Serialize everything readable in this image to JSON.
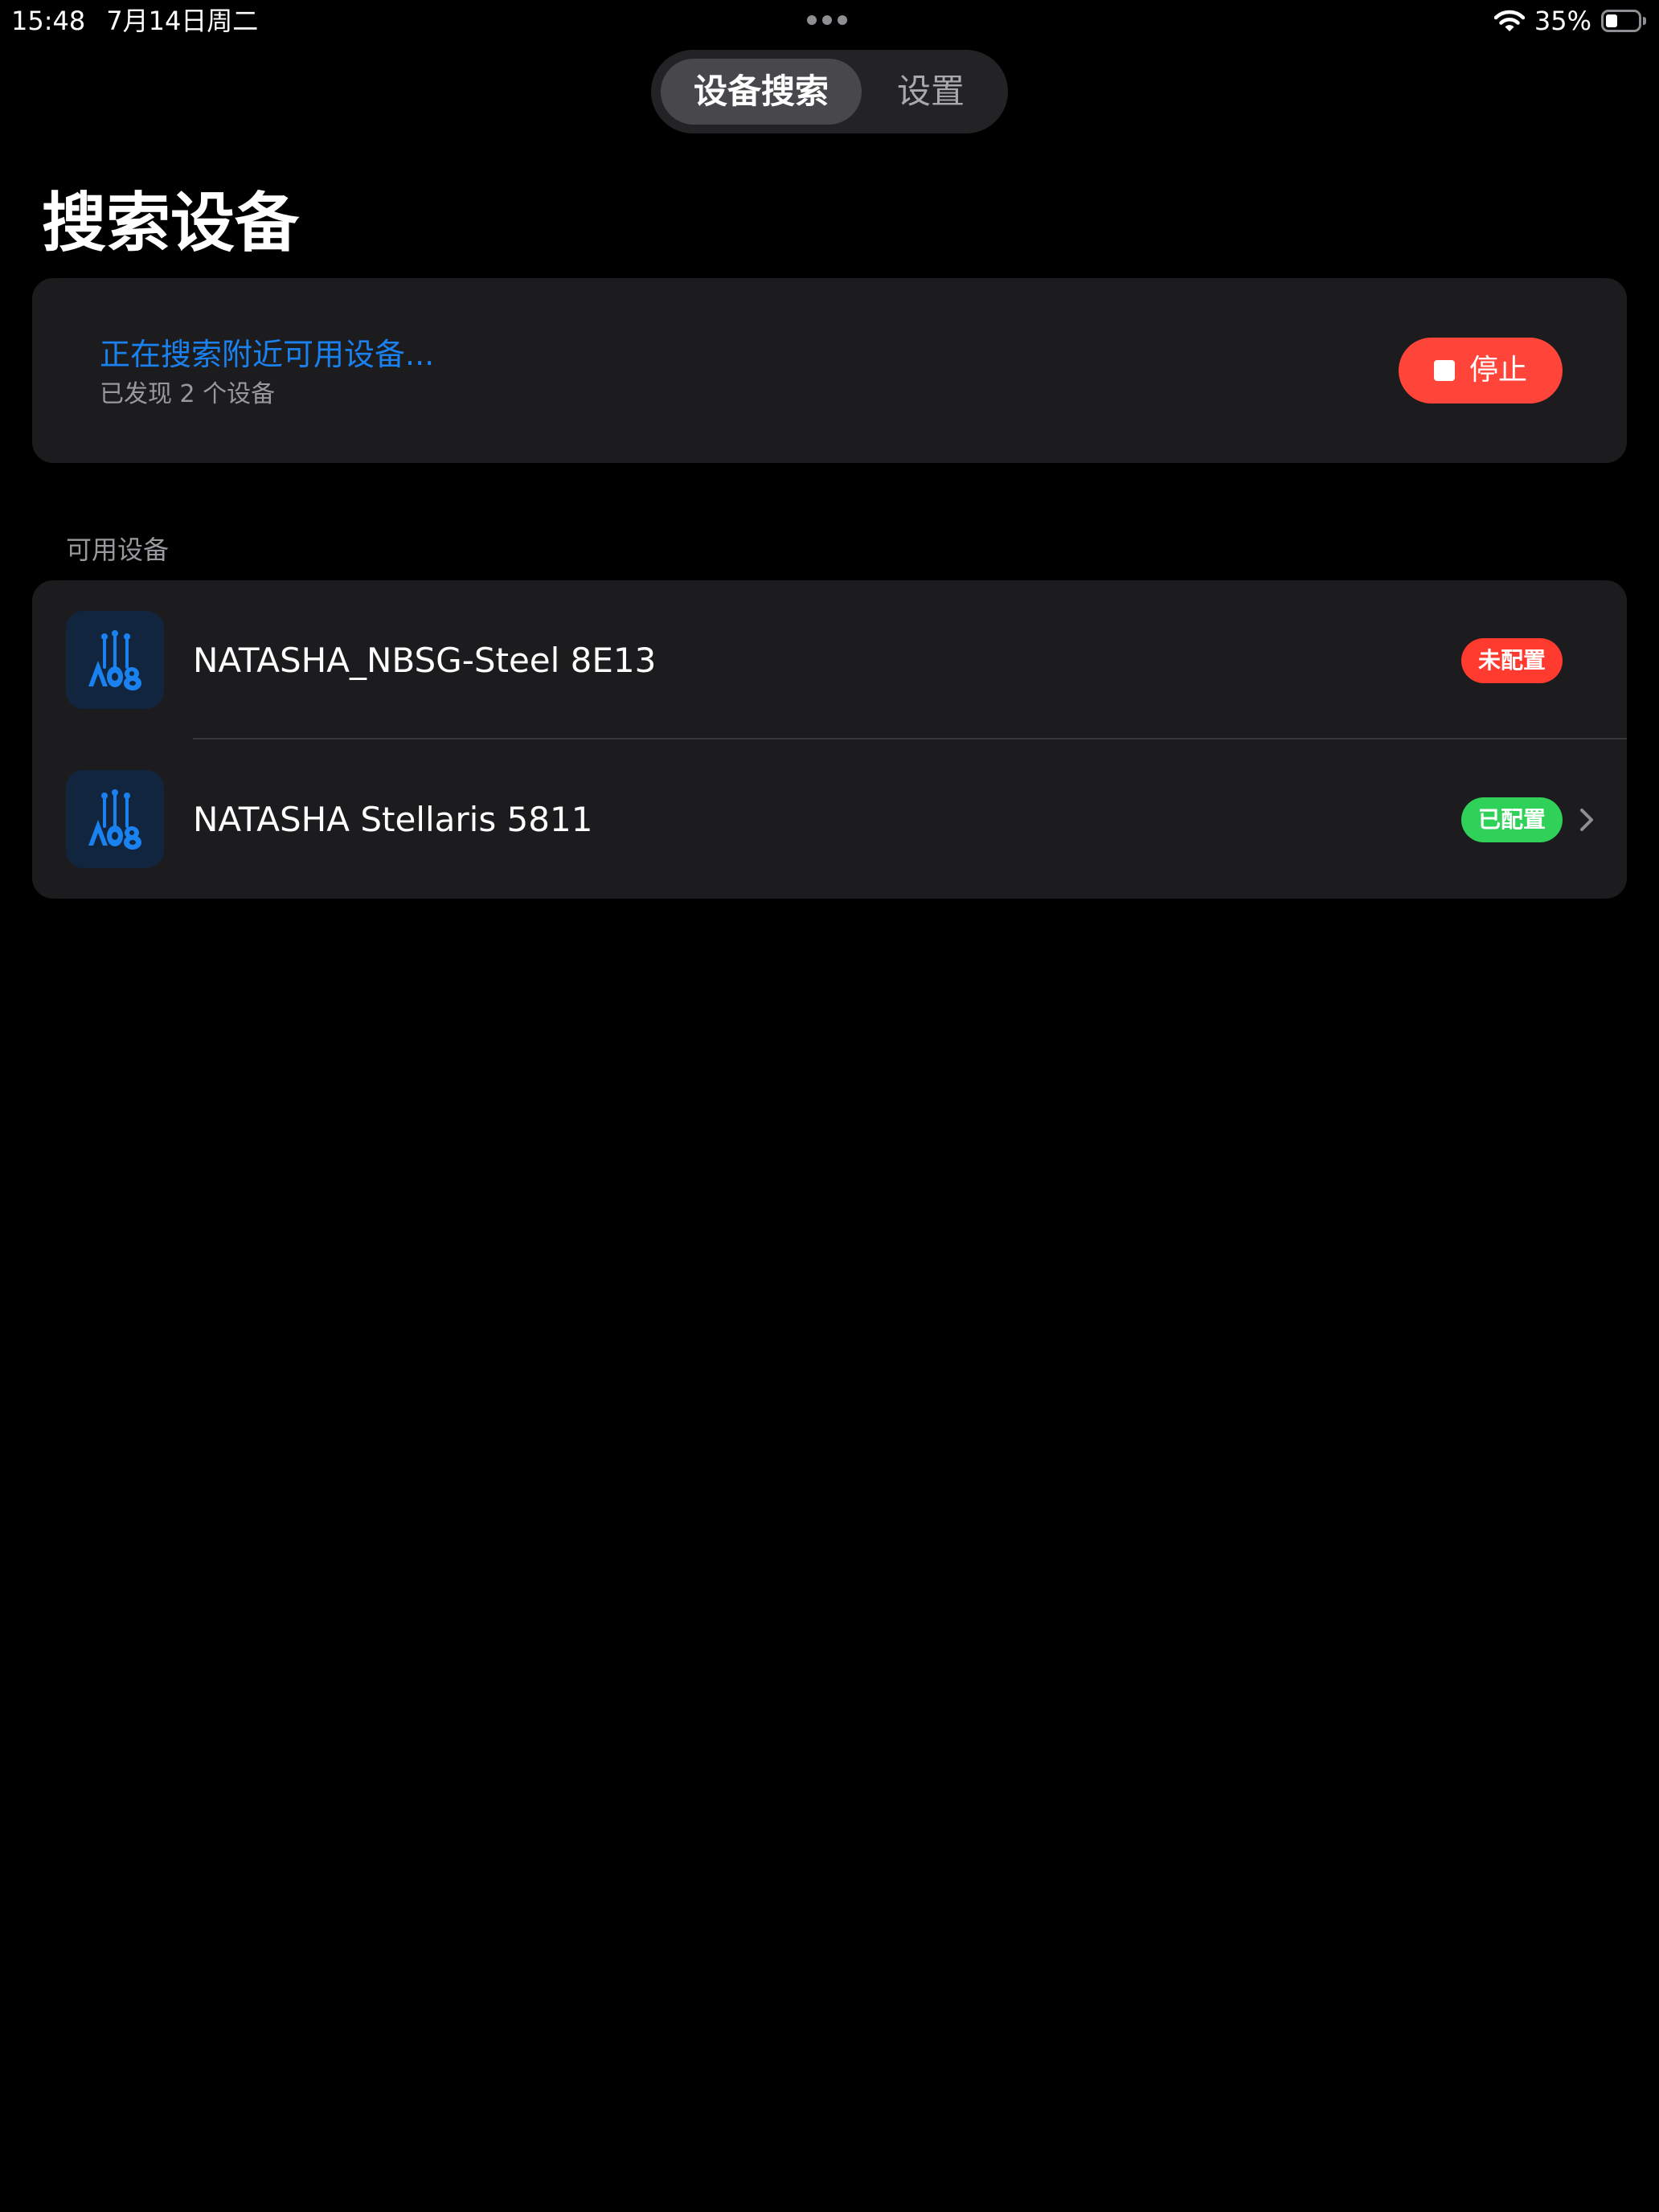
{
  "status_bar": {
    "time": "15:48",
    "date": "7月14日周二",
    "battery_percent": "35%",
    "battery_level": 0.35,
    "icons": [
      "wifi-icon",
      "battery-icon",
      "multitask-dots-icon"
    ]
  },
  "tabs": {
    "search": "设备搜索",
    "settings": "设置",
    "active": "search"
  },
  "page": {
    "title": "搜索设备"
  },
  "search_card": {
    "status": "正在搜索附近可用设备...",
    "found": "已发现 2 个设备",
    "stop_label": "停止",
    "stop_icon": "stop-square-icon"
  },
  "devices": {
    "section_title": "可用设备",
    "items": [
      {
        "name": "NATASHA_NBSG-Steel 8E13",
        "badge": "未配置",
        "badge_color": "#ff3b30",
        "icon": "guitar-logo-icon",
        "has_chevron": false
      },
      {
        "name": "NATASHA Stellaris 5811",
        "badge": "已配置",
        "badge_color": "#30d158",
        "icon": "guitar-logo-icon",
        "has_chevron": true
      }
    ]
  },
  "colors": {
    "background": "#000000",
    "card": "#1c1c1e",
    "accent_blue": "#1a82f0",
    "stop_red": "#ff453a",
    "secondary_text": "#98989d"
  }
}
